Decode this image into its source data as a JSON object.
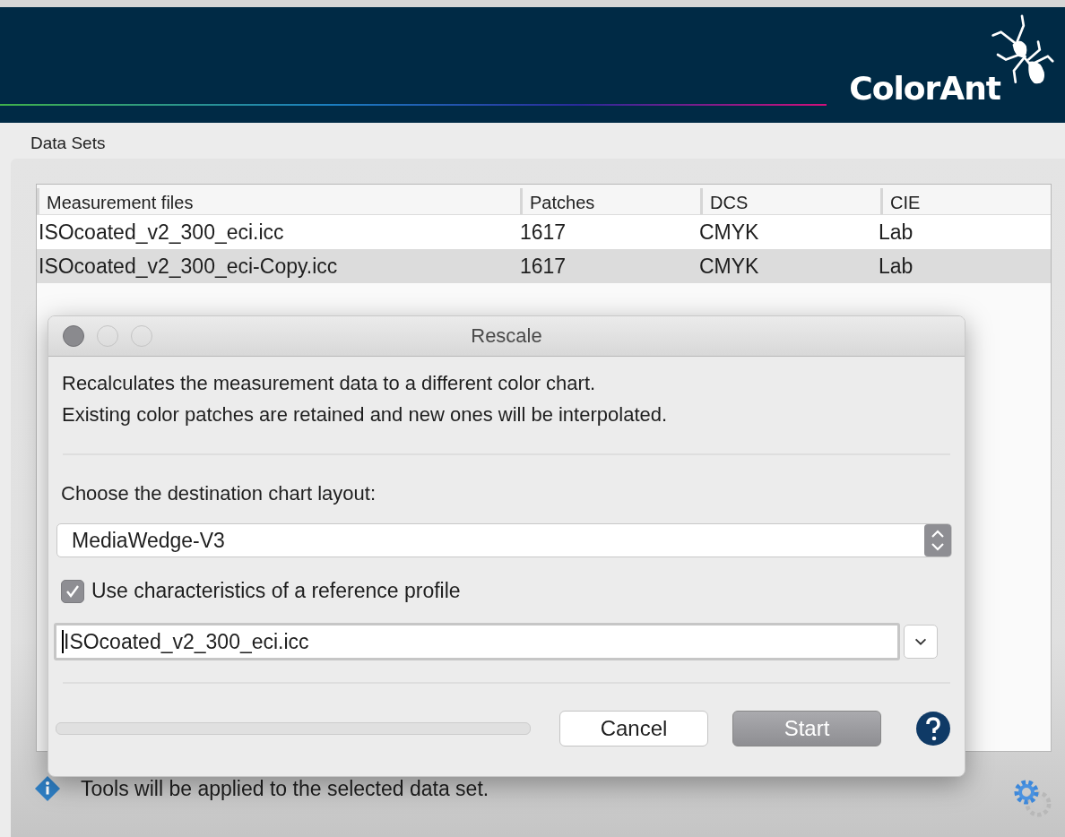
{
  "header": {
    "logo": "ColorAnt"
  },
  "section_title": "Data Sets",
  "table": {
    "columns": [
      "Measurement files",
      "Patches",
      "DCS",
      "CIE"
    ],
    "rows": [
      {
        "cells": [
          "ISOcoated_v2_300_eci.icc",
          "1617",
          "CMYK",
          "Lab"
        ],
        "selected": false
      },
      {
        "cells": [
          "ISOcoated_v2_300_eci-Copy.icc",
          "1617",
          "CMYK",
          "Lab"
        ],
        "selected": true
      }
    ]
  },
  "dialog": {
    "title": "Rescale",
    "description": [
      "Recalculates the measurement data to a different color chart.",
      "Existing color patches are retained and new ones will be interpolated."
    ],
    "chart_label": "Choose the destination chart layout:",
    "chart_select": {
      "value": "MediaWedge-V3"
    },
    "reference_checkbox": {
      "label": "Use characteristics of a reference profile",
      "checked": true
    },
    "profile_field": {
      "value": "ISOcoated_v2_300_eci.icc"
    },
    "progress": {
      "level": 0
    },
    "buttons": [
      {
        "label": "Cancel",
        "kind": "secondary"
      },
      {
        "label": "Start",
        "kind": "primary"
      }
    ]
  },
  "status": "Tools will be applied to the selected data set."
}
